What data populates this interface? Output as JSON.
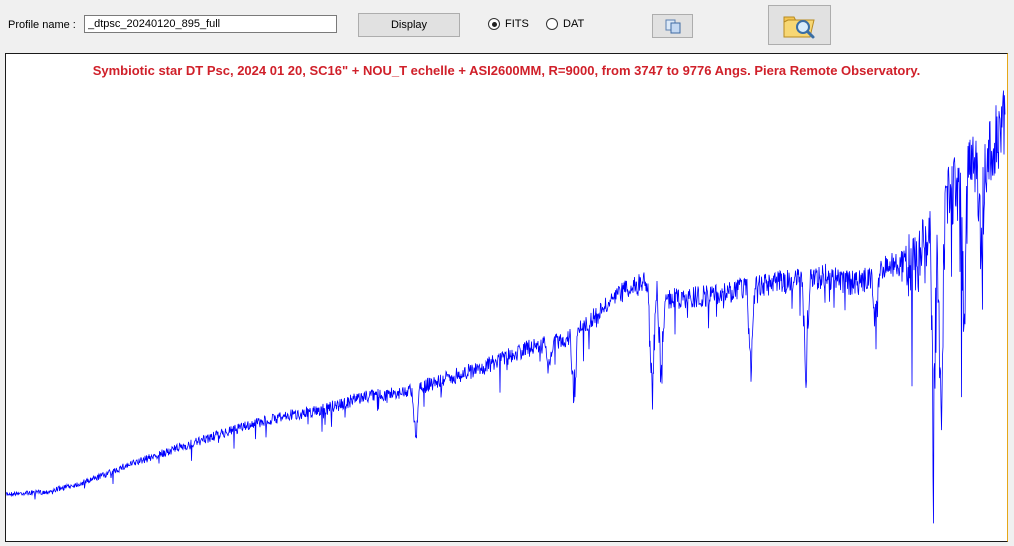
{
  "toolbar": {
    "profile_label": "Profile name :",
    "profile_value": "_dtpsc_20240120_895_full",
    "display_label": "Display",
    "format_options": [
      "FITS",
      "DAT"
    ],
    "selected_format": "FITS"
  },
  "icons": {
    "copy": "copy-icon",
    "open": "folder-search-icon"
  },
  "plot": {
    "title": "Symbiotic star DT Psc, 2024 01 20,  SC16\" + NOU_T echelle + ASI2600MM, R=9000, from 3747 to 9776 Angs.  Piera Remote Observatory.",
    "title_color": "#d0202a",
    "line_color": "#0000ff",
    "wavelength_range": [
      3747,
      9776
    ]
  }
}
